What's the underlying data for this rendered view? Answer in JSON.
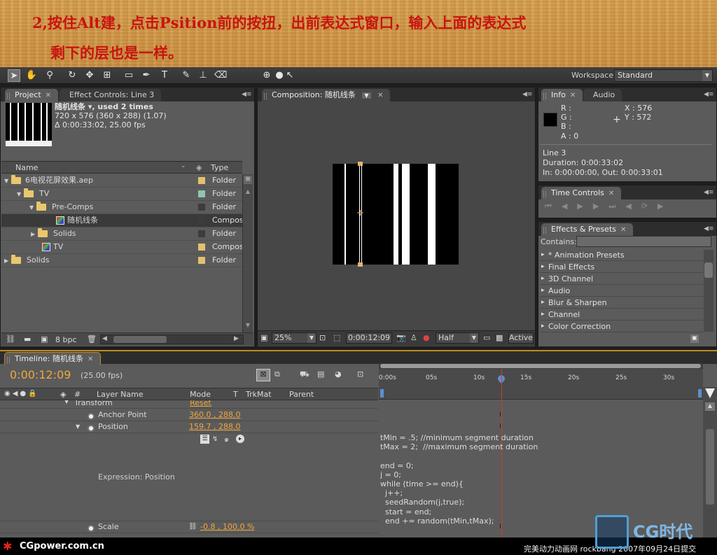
{
  "caption": {
    "line1": "2,按住Alt建，点击Psition前的按扭，出前表达式窗口，输入上面的表达式",
    "line2": "剩下的层也是一样。"
  },
  "toolbar": {
    "workspace_label": "Workspace:",
    "workspace_value": "Standard"
  },
  "project_panel": {
    "tabs": [
      "Project",
      "Effect Controls: Line 3"
    ],
    "item_name": "随机线条 ▾, used 2 times",
    "item_dims": "720 x 576  (360 x 288) (1.07)",
    "item_duration": "Δ 0:00:33:02, 25.00 fps",
    "col_name": "Name",
    "col_type": "Type",
    "rows": [
      {
        "name": "6电视花屏效果.aep",
        "type": "Folder",
        "label": "#e3c070"
      },
      {
        "name": "TV",
        "type": "Folder",
        "label": "#8fc4b8"
      },
      {
        "name": "Pre-Comps",
        "type": "Folder",
        "label": "#3c3c3c"
      },
      {
        "name": "随机线条",
        "type": "Composit",
        "label": "#3c3c3c"
      },
      {
        "name": "Solids",
        "type": "Folder",
        "label": "#3c3c3c"
      },
      {
        "name": "TV",
        "type": "Composit",
        "label": "#e3c070"
      },
      {
        "name": "Solids",
        "type": "Folder",
        "label": "#e3c070"
      }
    ],
    "bpc": "8 bpc"
  },
  "composition": {
    "tab": "Composition: 随机线条",
    "zoom": "25%",
    "timecode": "0:00:12:09",
    "resolution": "Half",
    "camera": "Active"
  },
  "info_panel": {
    "tabs": [
      "Info",
      "Audio"
    ],
    "r": "R :",
    "g": "G :",
    "b": "B :",
    "a": "A : 0",
    "x": "X : 576",
    "y": "Y : 572",
    "layer": "Line 3",
    "duration": "Duration: 0:00:33:02",
    "inout": "In: 0:00:00:00, Out: 0:00:33:01"
  },
  "time_controls": {
    "tab": "Time Controls"
  },
  "effects_presets": {
    "tab": "Effects & Presets",
    "contains_label": "Contains:",
    "items": [
      "* Animation Presets",
      "Final Effects",
      "3D Channel",
      "Audio",
      "Blur & Sharpen",
      "Channel",
      "Color Correction"
    ]
  },
  "timeline": {
    "tab": "Timeline: 随机线条",
    "timecode": "0:00:12:09",
    "fps": "(25.00 fps)",
    "columns": [
      "#",
      "Layer Name",
      "Mode",
      "T",
      "TrkMat",
      "Parent"
    ],
    "ruler": [
      "0:00s",
      "05s",
      "10s",
      "15s",
      "20s",
      "25s",
      "30s"
    ],
    "rows": {
      "transform": "Transform",
      "reset": "Reset",
      "anchor_label": "Anchor Point",
      "anchor_value": "360.0 , 288.0",
      "position_label": "Position",
      "position_value": "159.7 , 288.0",
      "expression_label": "Expression: Position",
      "scale_label": "Scale",
      "scale_value": "-0.8 , 100.0 %"
    },
    "expression": "tMin = .5; //minimum segment duration\ntMax = 2;  //maximum segment duration\n\nend = 0;\nj = 0;\nwhile (time >= end){\n  j++;\n  seedRandom(j,true);\n  start = end;\n  end += random(tMin,tMax);"
  },
  "footer": {
    "left": "CGpower.com.cn",
    "right": "完美动力动画网 rockbang 2007年09月24日提交",
    "logo": "CG时代"
  }
}
